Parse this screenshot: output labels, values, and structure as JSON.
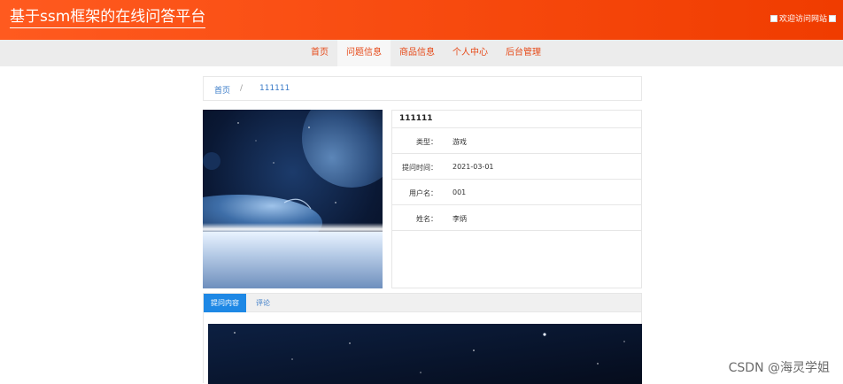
{
  "header": {
    "site_title": "基于ssm框架的在线问答平台",
    "welcome_text": "欢迎访问网站"
  },
  "nav": {
    "items": [
      {
        "label": "首页"
      },
      {
        "label": "问题信息"
      },
      {
        "label": "商品信息"
      },
      {
        "label": "个人中心"
      },
      {
        "label": "后台管理"
      }
    ],
    "active_index": 1
  },
  "breadcrumb": {
    "home": "首页",
    "separator": "/",
    "current": "111111"
  },
  "detail": {
    "title": "111111",
    "rows": [
      {
        "label": "类型：",
        "value": "游戏"
      },
      {
        "label": "提问时间：",
        "value": "2021-03-01"
      },
      {
        "label": "用户名：",
        "value": "001"
      },
      {
        "label": "姓名：",
        "value": "李炳"
      }
    ]
  },
  "tabs": [
    {
      "label": "提问内容"
    },
    {
      "label": "评论"
    }
  ],
  "watermark": "CSDN @海灵学姐",
  "colors": {
    "header_orange": "#f24a0c",
    "nav_text": "#e64a19",
    "link_blue": "#3a7bc8",
    "tab_active": "#1e88e5"
  }
}
